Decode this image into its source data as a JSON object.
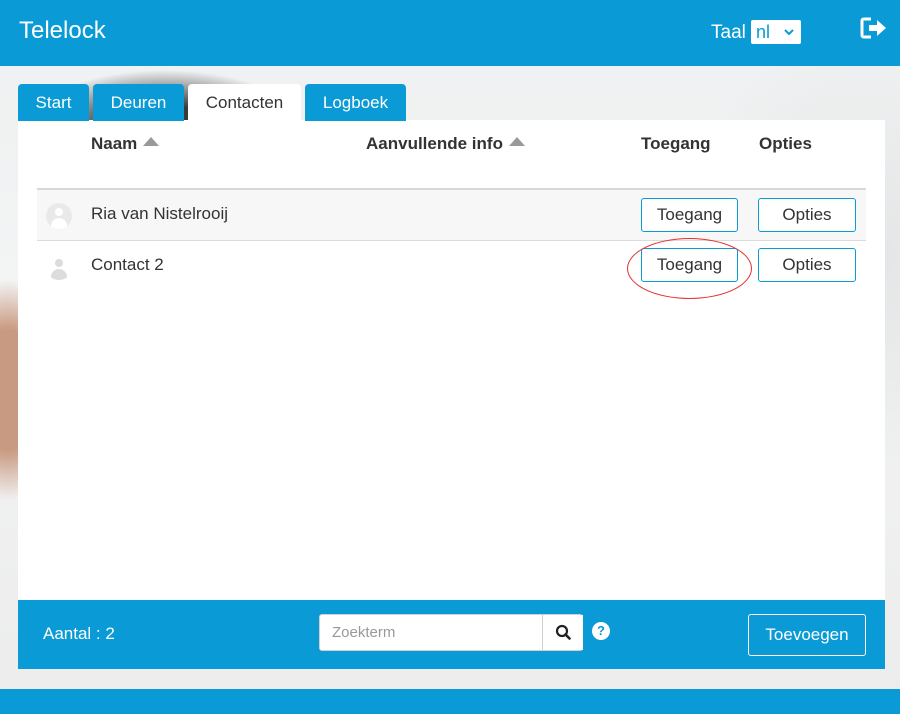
{
  "app": {
    "title": "Telelock"
  },
  "header": {
    "language_label": "Taal",
    "language_value": "nl"
  },
  "tabs": [
    {
      "label": "Start",
      "active": false
    },
    {
      "label": "Deuren",
      "active": false
    },
    {
      "label": "Contacten",
      "active": true
    },
    {
      "label": "Logboek",
      "active": false
    }
  ],
  "table": {
    "columns": {
      "name": "Naam",
      "info": "Aanvullende info",
      "access": "Toegang",
      "options": "Opties"
    },
    "rows": [
      {
        "name": "Ria van Nistelrooij",
        "info": "",
        "access_button": "Toegang",
        "options_button": "Opties"
      },
      {
        "name": "Contact 2",
        "info": "",
        "access_button": "Toegang",
        "options_button": "Opties"
      }
    ]
  },
  "footer": {
    "count_text": "Aantal : 2",
    "search_placeholder": "Zoekterm",
    "add_button": "Toevoegen"
  },
  "icons": {
    "logout": "logout-icon",
    "search": "search-icon",
    "help": "help-icon",
    "avatar": "user-avatar-icon",
    "sort": "sort-asc-icon"
  },
  "colors": {
    "brand": "#0a9ad6",
    "highlight": "#e53030"
  }
}
